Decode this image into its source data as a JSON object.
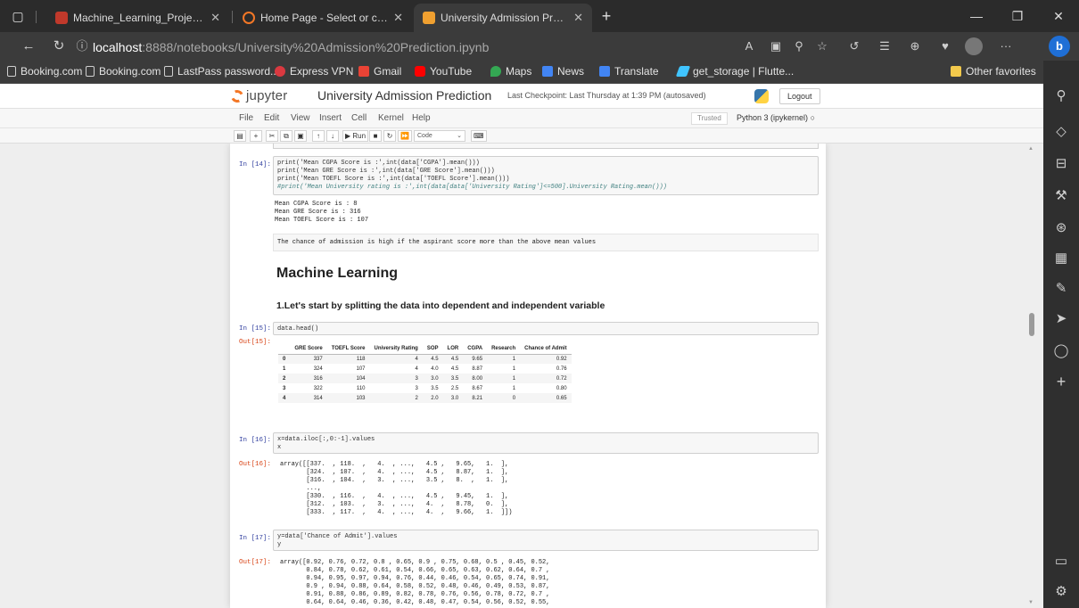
{
  "browser": {
    "tabs": [
      {
        "label": "Machine_Learning_Projects_Vide",
        "favicon_color": "#c0392b"
      },
      {
        "label": "Home Page - Select or create a n",
        "favicon_color": "#f37726"
      },
      {
        "label": "University Admission Prediction",
        "favicon_color": "#f0a030"
      }
    ],
    "new_tab_icon": "plus-icon",
    "url": {
      "host": "localhost",
      "path": ":8888/notebooks/University%20Admission%20Prediction.ipynb"
    },
    "bookmarks": [
      {
        "label": "Booking.com",
        "icon": "page-icon"
      },
      {
        "label": "Booking.com",
        "icon": "page-icon"
      },
      {
        "label": "LastPass password...",
        "icon": "page-icon"
      },
      {
        "label": "Express VPN",
        "icon": "expressvpn-icon",
        "color": "#da3940"
      },
      {
        "label": "Gmail",
        "icon": "gmail-icon",
        "color": "#ea4335"
      },
      {
        "label": "YouTube",
        "icon": "youtube-icon",
        "color": "#ff0000"
      },
      {
        "label": "Maps",
        "icon": "maps-icon",
        "color": "#34a853"
      },
      {
        "label": "News",
        "icon": "news-icon",
        "color": "#4285f4"
      },
      {
        "label": "Translate",
        "icon": "translate-icon",
        "color": "#4285f4"
      },
      {
        "label": "get_storage | Flutte...",
        "icon": "flutter-icon",
        "color": "#40c4ff"
      }
    ],
    "other_favorites": "Other favorites"
  },
  "jupyter": {
    "logo_text": "jupyter",
    "notebook_title": "University Admission Prediction",
    "checkpoint": "Last Checkpoint: Last Thursday at 1:39 PM  (autosaved)",
    "logout": "Logout",
    "menu": [
      "File",
      "Edit",
      "View",
      "Insert",
      "Cell",
      "Kernel",
      "Help"
    ],
    "trusted": "Trusted",
    "kernel": "Python 3 (ipykernel)",
    "toolbar": {
      "run": "▶ Run",
      "cell_type": "Code"
    }
  },
  "cells": {
    "c14": {
      "prompt": "In [14]:",
      "lines": [
        "print('Mean CGPA Score is :',int(data['CGPA'].mean()))",
        "print('Mean GRE Score is :',int(data['GRE Score'].mean()))",
        "print('Mean TOEFL Score is :',int(data['TOEFL Score'].mean()))",
        "#print('Mean University rating is :',int(data[data['University Rating']<=500].University Rating.mean()))"
      ],
      "output": [
        "Mean CGPA Score is : 8",
        "Mean GRE Score is : 316",
        "Mean TOEFL Score is : 107"
      ]
    },
    "md_note": "The chance of admission is high if the aspirant score more than the above mean values",
    "md_h1": "Machine Learning",
    "md_h3": "1.Let's start by splitting the data into dependent and independent variable",
    "c15": {
      "prompt": "In [15]:",
      "code": "data.head()",
      "out_prompt": "Out[15]:",
      "table": {
        "columns": [
          "",
          "GRE Score",
          "TOEFL Score",
          "University Rating",
          "SOP",
          "LOR",
          "CGPA",
          "Research",
          "Chance of Admit"
        ],
        "rows": [
          [
            "0",
            "337",
            "118",
            "4",
            "4.5",
            "4.5",
            "9.65",
            "1",
            "0.92"
          ],
          [
            "1",
            "324",
            "107",
            "4",
            "4.0",
            "4.5",
            "8.87",
            "1",
            "0.76"
          ],
          [
            "2",
            "316",
            "104",
            "3",
            "3.0",
            "3.5",
            "8.00",
            "1",
            "0.72"
          ],
          [
            "3",
            "322",
            "110",
            "3",
            "3.5",
            "2.5",
            "8.67",
            "1",
            "0.80"
          ],
          [
            "4",
            "314",
            "103",
            "2",
            "2.0",
            "3.0",
            "8.21",
            "0",
            "0.65"
          ]
        ]
      }
    },
    "c16": {
      "prompt": "In [16]:",
      "lines": [
        "x=data.iloc[:,0:-1].values",
        "x"
      ],
      "out_prompt": "Out[16]:",
      "output": [
        "array([[337.  , 118.  ,   4.  , ...,   4.5 ,   9.65,   1.  ],",
        "       [324.  , 107.  ,   4.  , ...,   4.5 ,   8.87,   1.  ],",
        "       [316.  , 104.  ,   3.  , ...,   3.5 ,   8.  ,   1.  ],",
        "       ...,",
        "       [330.  , 116.  ,   4.  , ...,   4.5 ,   9.45,   1.  ],",
        "       [312.  , 103.  ,   3.  , ...,   4.  ,   8.78,   0.  ],",
        "       [333.  , 117.  ,   4.  , ...,   4.  ,   9.66,   1.  ]])"
      ]
    },
    "c17": {
      "prompt": "In [17]:",
      "lines": [
        "y=data['Chance of Admit'].values",
        "y"
      ],
      "out_prompt": "Out[17]:",
      "output": [
        "array([0.92, 0.76, 0.72, 0.8 , 0.65, 0.9 , 0.75, 0.68, 0.5 , 0.45, 0.52,",
        "       0.84, 0.78, 0.62, 0.61, 0.54, 0.66, 0.65, 0.63, 0.62, 0.64, 0.7 ,",
        "       0.94, 0.95, 0.97, 0.94, 0.76, 0.44, 0.46, 0.54, 0.65, 0.74, 0.91,",
        "       0.9 , 0.94, 0.88, 0.64, 0.58, 0.52, 0.48, 0.46, 0.49, 0.53, 0.87,",
        "       0.91, 0.88, 0.86, 0.89, 0.82, 0.78, 0.76, 0.56, 0.78, 0.72, 0.7 ,",
        "       0.64, 0.64, 0.46, 0.36, 0.42, 0.48, 0.47, 0.54, 0.56, 0.52, 0.55,"
      ]
    }
  }
}
